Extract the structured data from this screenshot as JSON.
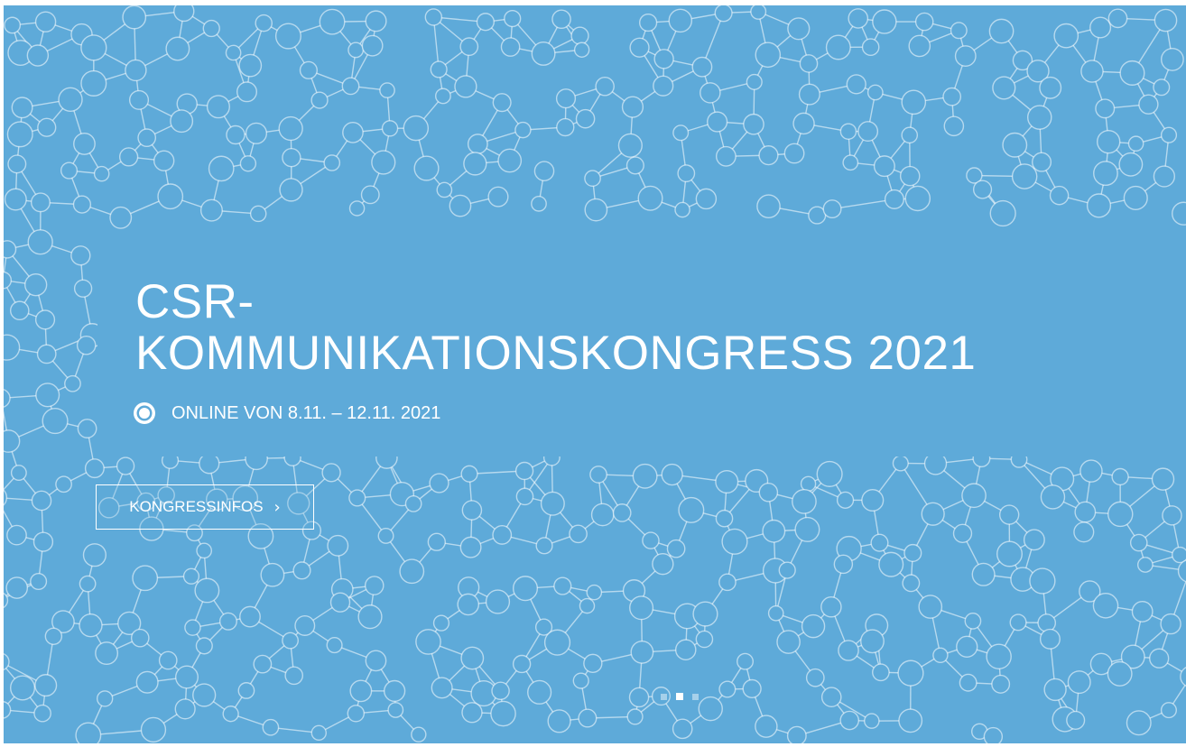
{
  "hero": {
    "title_line1": "CSR-",
    "title_line2": "KOMMUNIKATIONSKONGRESS 2021",
    "subtitle": "ONLINE VON 8.11. – 12.11. 2021",
    "subtitle_icon": "target-circle-icon",
    "cta_label": "KONGRESSINFOS",
    "cta_icon": "chevron-right-icon",
    "background_color": "#5eaad9",
    "pattern": "network-nodes-pattern",
    "slider": {
      "count": 3,
      "active_index": 1
    }
  }
}
